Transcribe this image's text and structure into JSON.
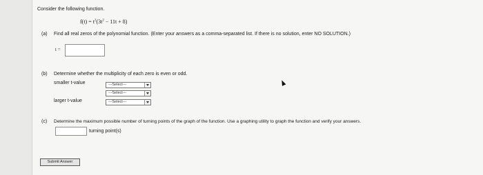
{
  "intro": "Consider the following function.",
  "function": {
    "lhs": "f(t) = t",
    "exp1": "2",
    "mid": "(3t",
    "exp2": "2",
    "rest": " − 11t + 8)"
  },
  "part_a": {
    "label": "(a)",
    "text": "Find all real zeros of the polynomial function. (Enter your answers as a comma-separated list. If there is no solution, enter NO SOLUTION.)",
    "var_label": "t =",
    "value": ""
  },
  "part_b": {
    "label": "(b)",
    "text": "Determine whether the multiplicity of each zero is even or odd.",
    "smaller_label": "smaller t-value",
    "larger_label": "larger t-value",
    "selects": [
      "---Select---",
      "---Select---",
      "---Select---"
    ]
  },
  "part_c": {
    "label": "(c)",
    "text": "Determine the maximum possible number of turning points of the graph of the function. Use a graphing utility to graph the function and verify your answers.",
    "suffix": "turning point(s)",
    "value": ""
  },
  "submit_label": "Submit Answer",
  "colors": {
    "page_bg": "#e9e9e7",
    "panel_bg": "#f6f6f4",
    "border": "#8e8e8e"
  }
}
